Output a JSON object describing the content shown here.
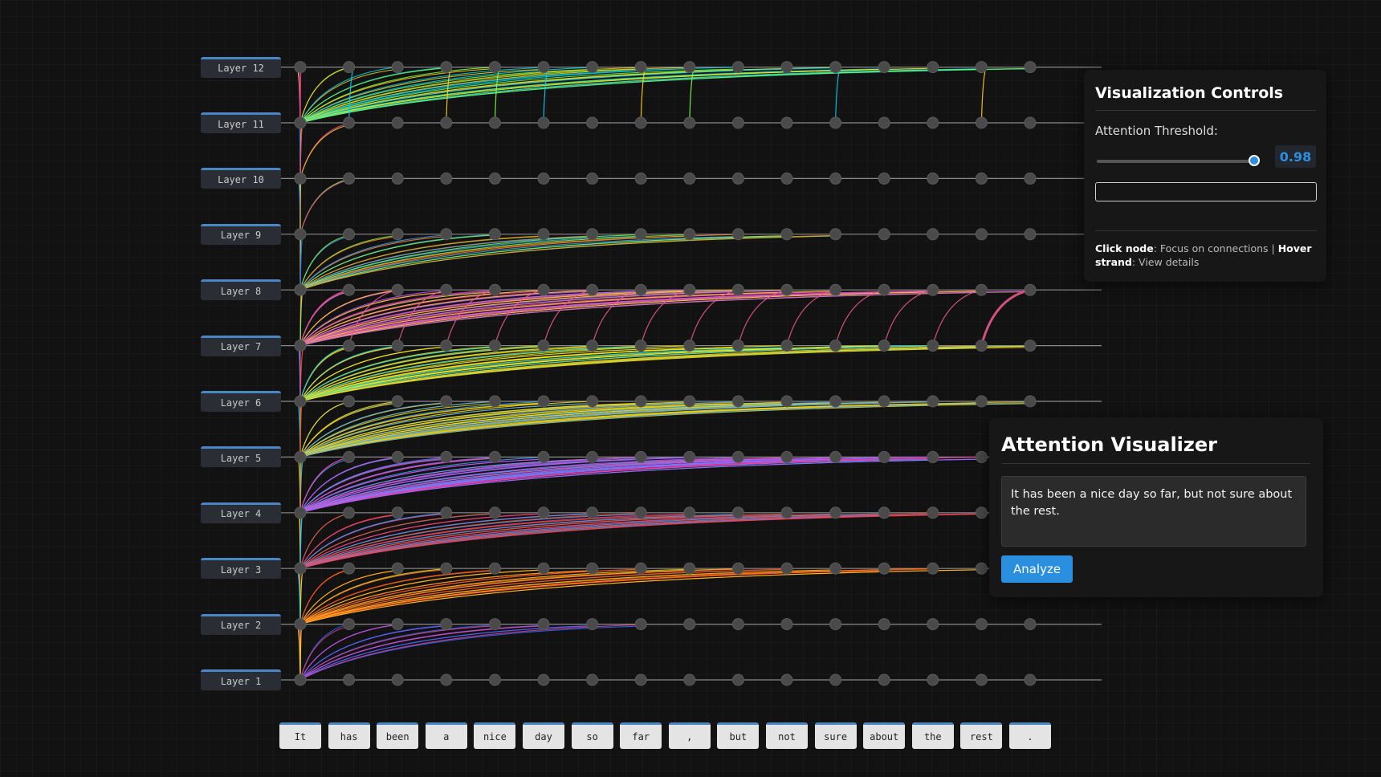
{
  "layers": [
    "Layer 1",
    "Layer 2",
    "Layer 3",
    "Layer 4",
    "Layer 5",
    "Layer 6",
    "Layer 7",
    "Layer 8",
    "Layer 9",
    "Layer 10",
    "Layer 11",
    "Layer 12"
  ],
  "tokens": [
    "It",
    "has",
    "been",
    "a",
    "nice",
    "day",
    "so",
    "far",
    ",",
    "but",
    "not",
    "sure",
    "about",
    "the",
    "rest",
    "."
  ],
  "controls": {
    "title": "Visualization Controls",
    "threshold_label": "Attention Threshold:",
    "threshold_value": "0.98",
    "threshold_level": 0.98,
    "help_click_bold": "Click node",
    "help_click_text": ": Focus on connections | ",
    "help_hover_bold": "Hover strand",
    "help_hover_text": ": View details"
  },
  "visualizer": {
    "title": "Attention Visualizer",
    "input_text": "It has been a nice day so far, but not sure about the rest.",
    "analyze_label": "Analyze"
  },
  "colors": {
    "accent": "#2b8fe0",
    "palette": [
      "#e84393",
      "#ff3ca5",
      "#ffd21e",
      "#ffe600",
      "#00d3f0",
      "#3ea8ff",
      "#ff8a2a",
      "#ff4a1c",
      "#b05cff",
      "#7cff4a",
      "#2b6cff",
      "#f0c419"
    ]
  }
}
